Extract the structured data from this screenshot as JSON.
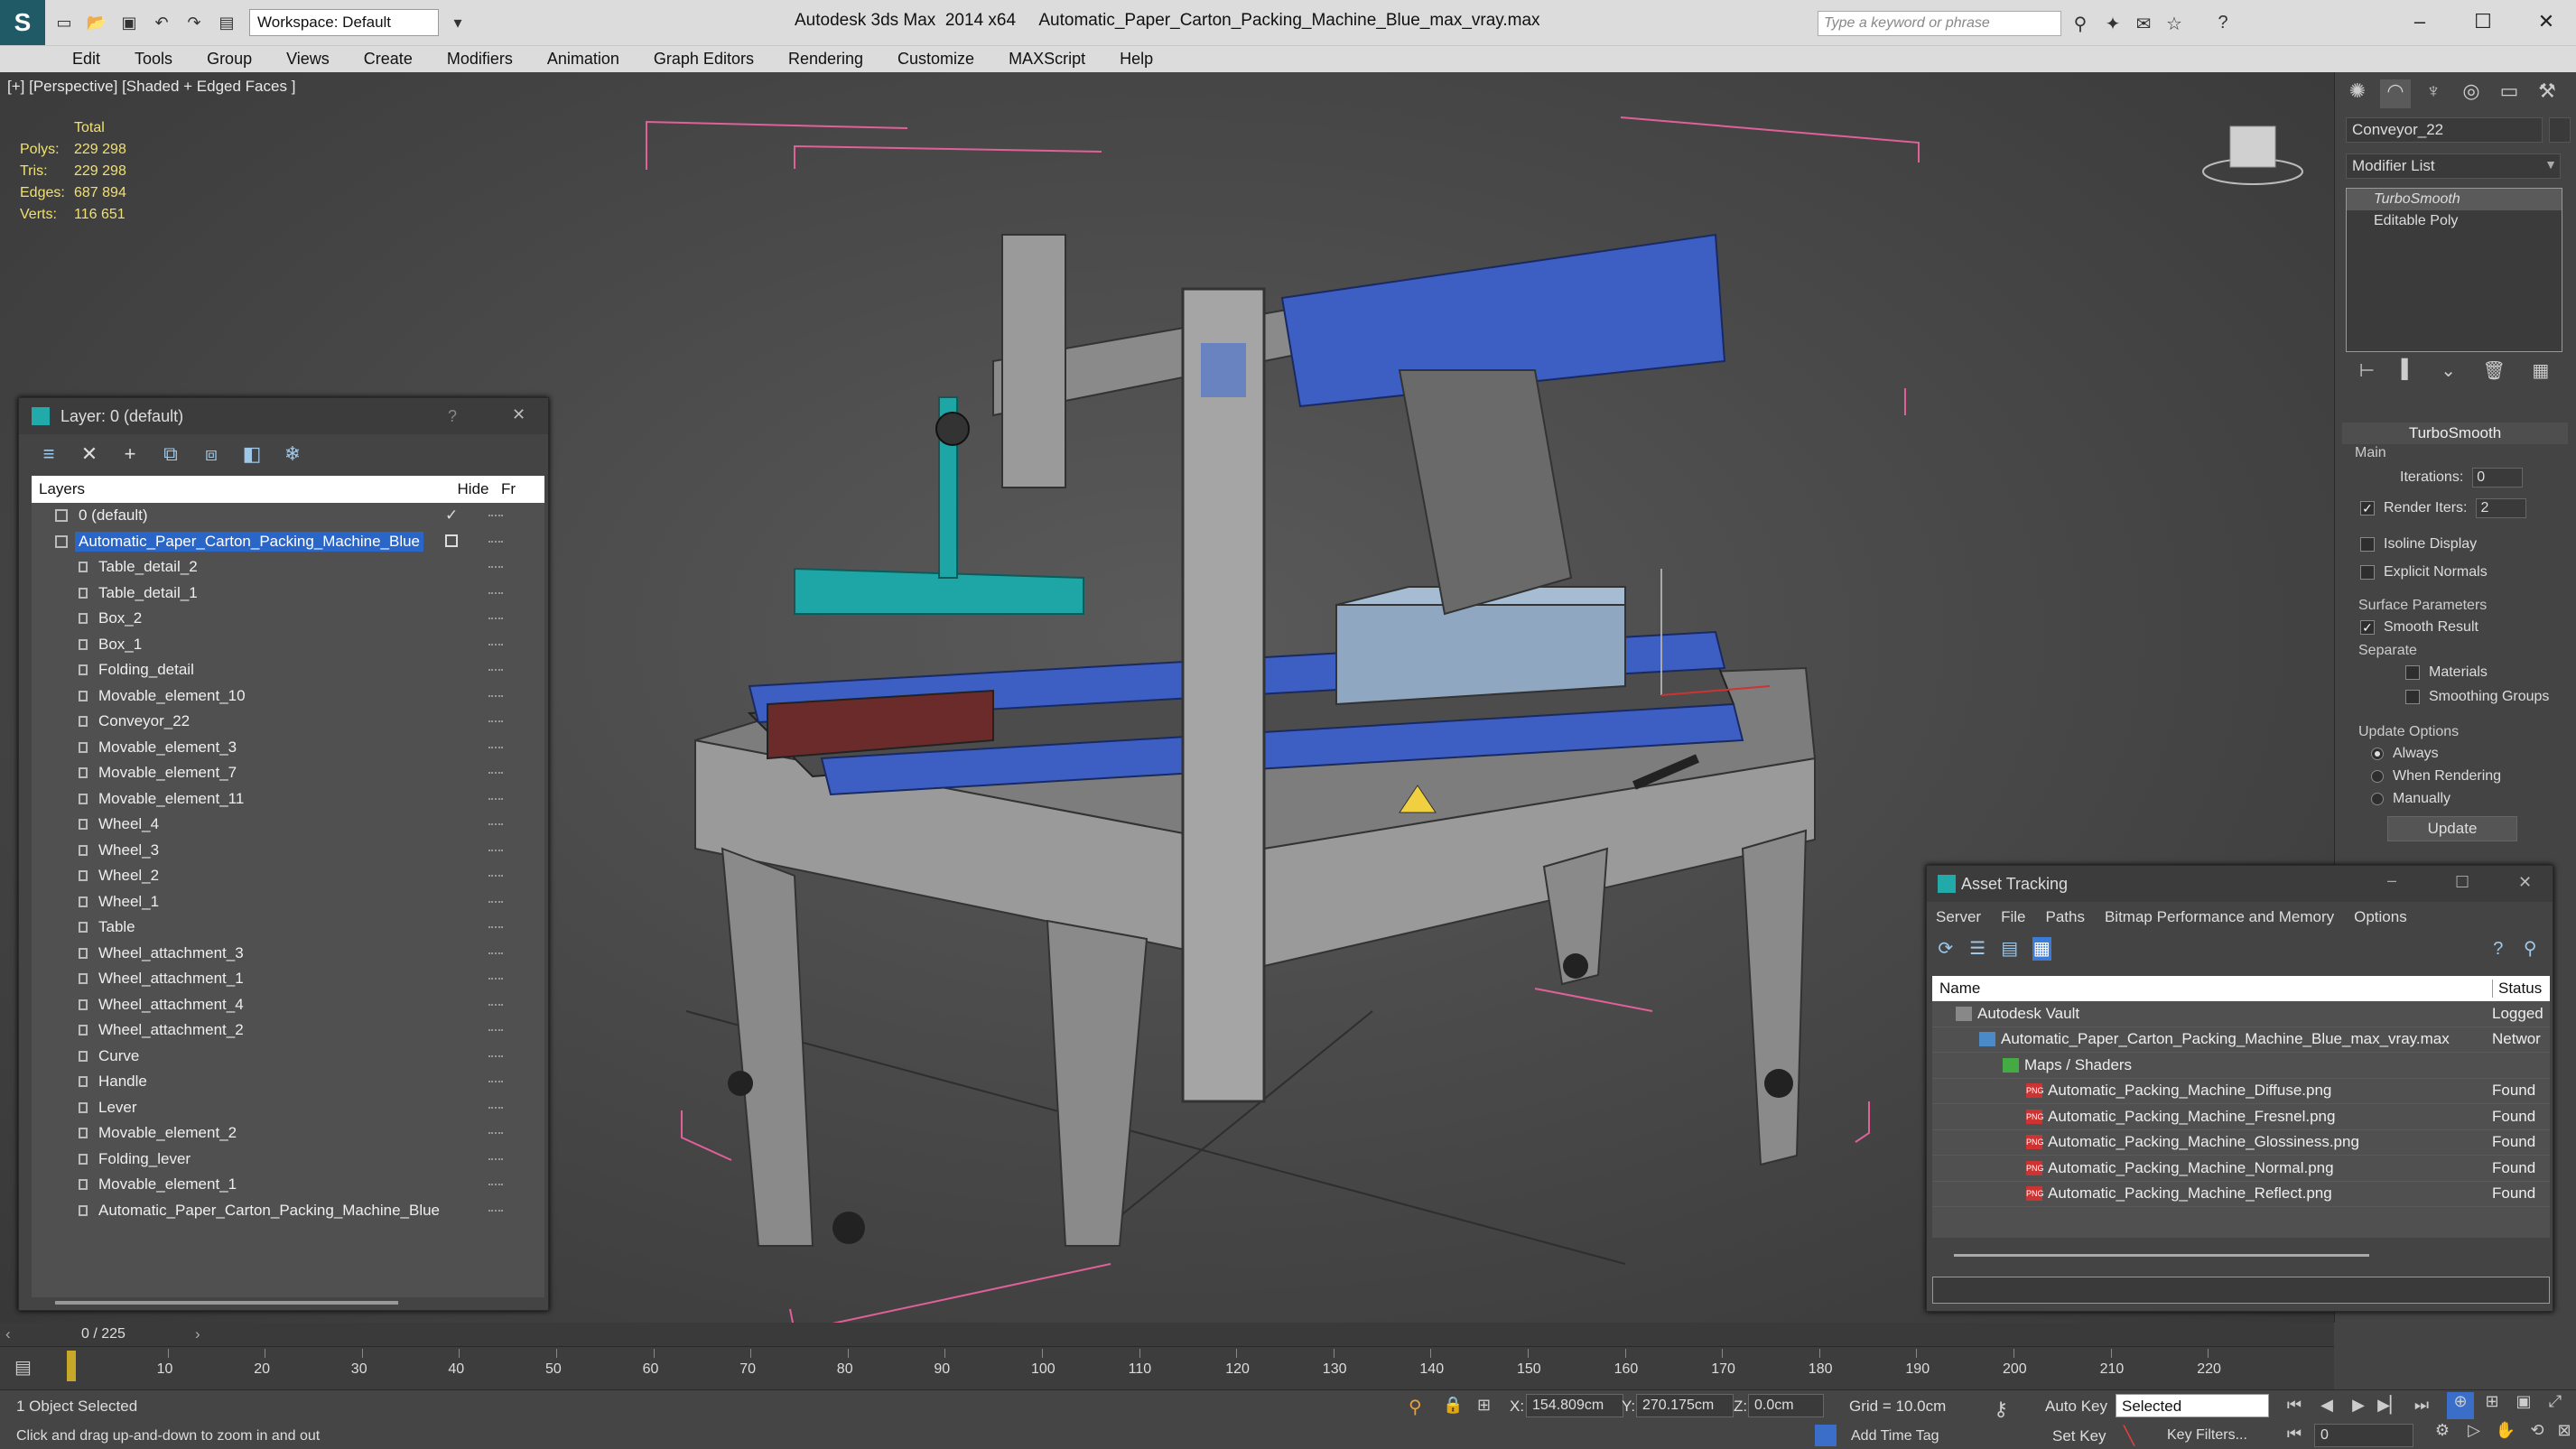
{
  "app": {
    "title": "Autodesk 3ds Max  2014 x64     Automatic_Paper_Carton_Packing_Machine_Blue_max_vray.max",
    "workspace": "Workspace: Default",
    "search_placeholder": "Type a keyword or phrase"
  },
  "menu": [
    "Edit",
    "Tools",
    "Group",
    "Views",
    "Create",
    "Modifiers",
    "Animation",
    "Graph Editors",
    "Rendering",
    "Customize",
    "MAXScript",
    "Help"
  ],
  "viewport": {
    "label": "[+] [Perspective] [Shaded + Edged Faces ]",
    "stats": {
      "header": "Total",
      "rows": [
        {
          "k": "Polys:",
          "v": "229 298"
        },
        {
          "k": "Tris:",
          "v": "229 298"
        },
        {
          "k": "Edges:",
          "v": "687 894"
        },
        {
          "k": "Verts:",
          "v": "116 651"
        }
      ]
    }
  },
  "layer_dialog": {
    "title": "Layer: 0 (default)",
    "help": "?",
    "close": "✕",
    "col_layers": "Layers",
    "col_hide": "Hide",
    "col_fr": "Fr",
    "layers": [
      {
        "name": "0 (default)",
        "level": 1,
        "current": true
      },
      {
        "name": "Automatic_Paper_Carton_Packing_Machine_Blue",
        "level": 1,
        "selected": true
      },
      {
        "name": "Table_detail_2",
        "level": 2
      },
      {
        "name": "Table_detail_1",
        "level": 2
      },
      {
        "name": "Box_2",
        "level": 2
      },
      {
        "name": "Box_1",
        "level": 2
      },
      {
        "name": "Folding_detail",
        "level": 2
      },
      {
        "name": "Movable_element_10",
        "level": 2
      },
      {
        "name": "Conveyor_22",
        "level": 2
      },
      {
        "name": "Movable_element_3",
        "level": 2
      },
      {
        "name": "Movable_element_7",
        "level": 2
      },
      {
        "name": "Movable_element_11",
        "level": 2
      },
      {
        "name": "Wheel_4",
        "level": 2
      },
      {
        "name": "Wheel_3",
        "level": 2
      },
      {
        "name": "Wheel_2",
        "level": 2
      },
      {
        "name": "Wheel_1",
        "level": 2
      },
      {
        "name": "Table",
        "level": 2
      },
      {
        "name": "Wheel_attachment_3",
        "level": 2
      },
      {
        "name": "Wheel_attachment_1",
        "level": 2
      },
      {
        "name": "Wheel_attachment_4",
        "level": 2
      },
      {
        "name": "Wheel_attachment_2",
        "level": 2
      },
      {
        "name": "Curve",
        "level": 2
      },
      {
        "name": "Handle",
        "level": 2
      },
      {
        "name": "Lever",
        "level": 2
      },
      {
        "name": "Movable_element_2",
        "level": 2
      },
      {
        "name": "Folding_lever",
        "level": 2
      },
      {
        "name": "Movable_element_1",
        "level": 2
      },
      {
        "name": "Automatic_Paper_Carton_Packing_Machine_Blue",
        "level": 2
      }
    ]
  },
  "command_panel": {
    "object_name": "Conveyor_22",
    "modifier_list": "Modifier List",
    "stack": [
      "TurboSmooth",
      "Editable Poly"
    ],
    "rollout": "TurboSmooth",
    "main_group": "Main",
    "iterations_label": "Iterations:",
    "iterations_value": "0",
    "render_iters_label": "Render Iters:",
    "render_iters_value": "2",
    "isoline": "Isoline Display",
    "explicit": "Explicit Normals",
    "surface_group": "Surface Parameters",
    "smooth_result": "Smooth Result",
    "separate": "Separate",
    "materials": "Materials",
    "smoothing_groups": "Smoothing Groups",
    "update_group": "Update Options",
    "always": "Always",
    "when_rendering": "When Rendering",
    "manually": "Manually",
    "update_btn": "Update"
  },
  "asset_tracking": {
    "title": "Asset Tracking",
    "menu": [
      "Server",
      "File",
      "Paths",
      "Bitmap Performance and Memory",
      "Options"
    ],
    "col_name": "Name",
    "col_status": "Status",
    "rows": [
      {
        "name": "Autodesk Vault",
        "status": "Logged",
        "indent": 1
      },
      {
        "name": "Automatic_Paper_Carton_Packing_Machine_Blue_max_vray.max",
        "status": "Networ",
        "indent": 2
      },
      {
        "name": "Maps / Shaders",
        "status": "",
        "indent": 3
      },
      {
        "name": "Automatic_Packing_Machine_Diffuse.png",
        "status": "Found",
        "indent": 4
      },
      {
        "name": "Automatic_Packing_Machine_Fresnel.png",
        "status": "Found",
        "indent": 4
      },
      {
        "name": "Automatic_Packing_Machine_Glossiness.png",
        "status": "Found",
        "indent": 4
      },
      {
        "name": "Automatic_Packing_Machine_Normal.png",
        "status": "Found",
        "indent": 4
      },
      {
        "name": "Automatic_Packing_Machine_Reflect.png",
        "status": "Found",
        "indent": 4
      }
    ]
  },
  "timeline": {
    "frame_counter": "0 / 225",
    "ticks": [
      "10",
      "20",
      "30",
      "40",
      "50",
      "60",
      "70",
      "80",
      "90",
      "100",
      "110",
      "120",
      "130",
      "140",
      "150",
      "160",
      "170",
      "180",
      "190",
      "200",
      "210",
      "220"
    ]
  },
  "status": {
    "selected": "1 Object Selected",
    "prompt": "Click and drag up-and-down to zoom in and out",
    "x_label": "X:",
    "x_value": "154.809cm",
    "y_label": "Y:",
    "y_value": "270.175cm",
    "z_label": "Z:",
    "z_value": "0.0cm",
    "grid": "Grid = 10.0cm",
    "auto_key": "Auto Key",
    "set_key": "Set Key",
    "selected_dropdown": "Selected",
    "key_filters": "Key Filters...",
    "add_time_tag": "Add Time Tag",
    "frame": "0"
  },
  "colors": {
    "selection_blue": "#2a66c8",
    "stats_yellow": "#f0e070",
    "conveyor_blue": "#3d5fc4",
    "bbox_pink": "#e0609a",
    "teal_part": "#1ea5a5"
  }
}
